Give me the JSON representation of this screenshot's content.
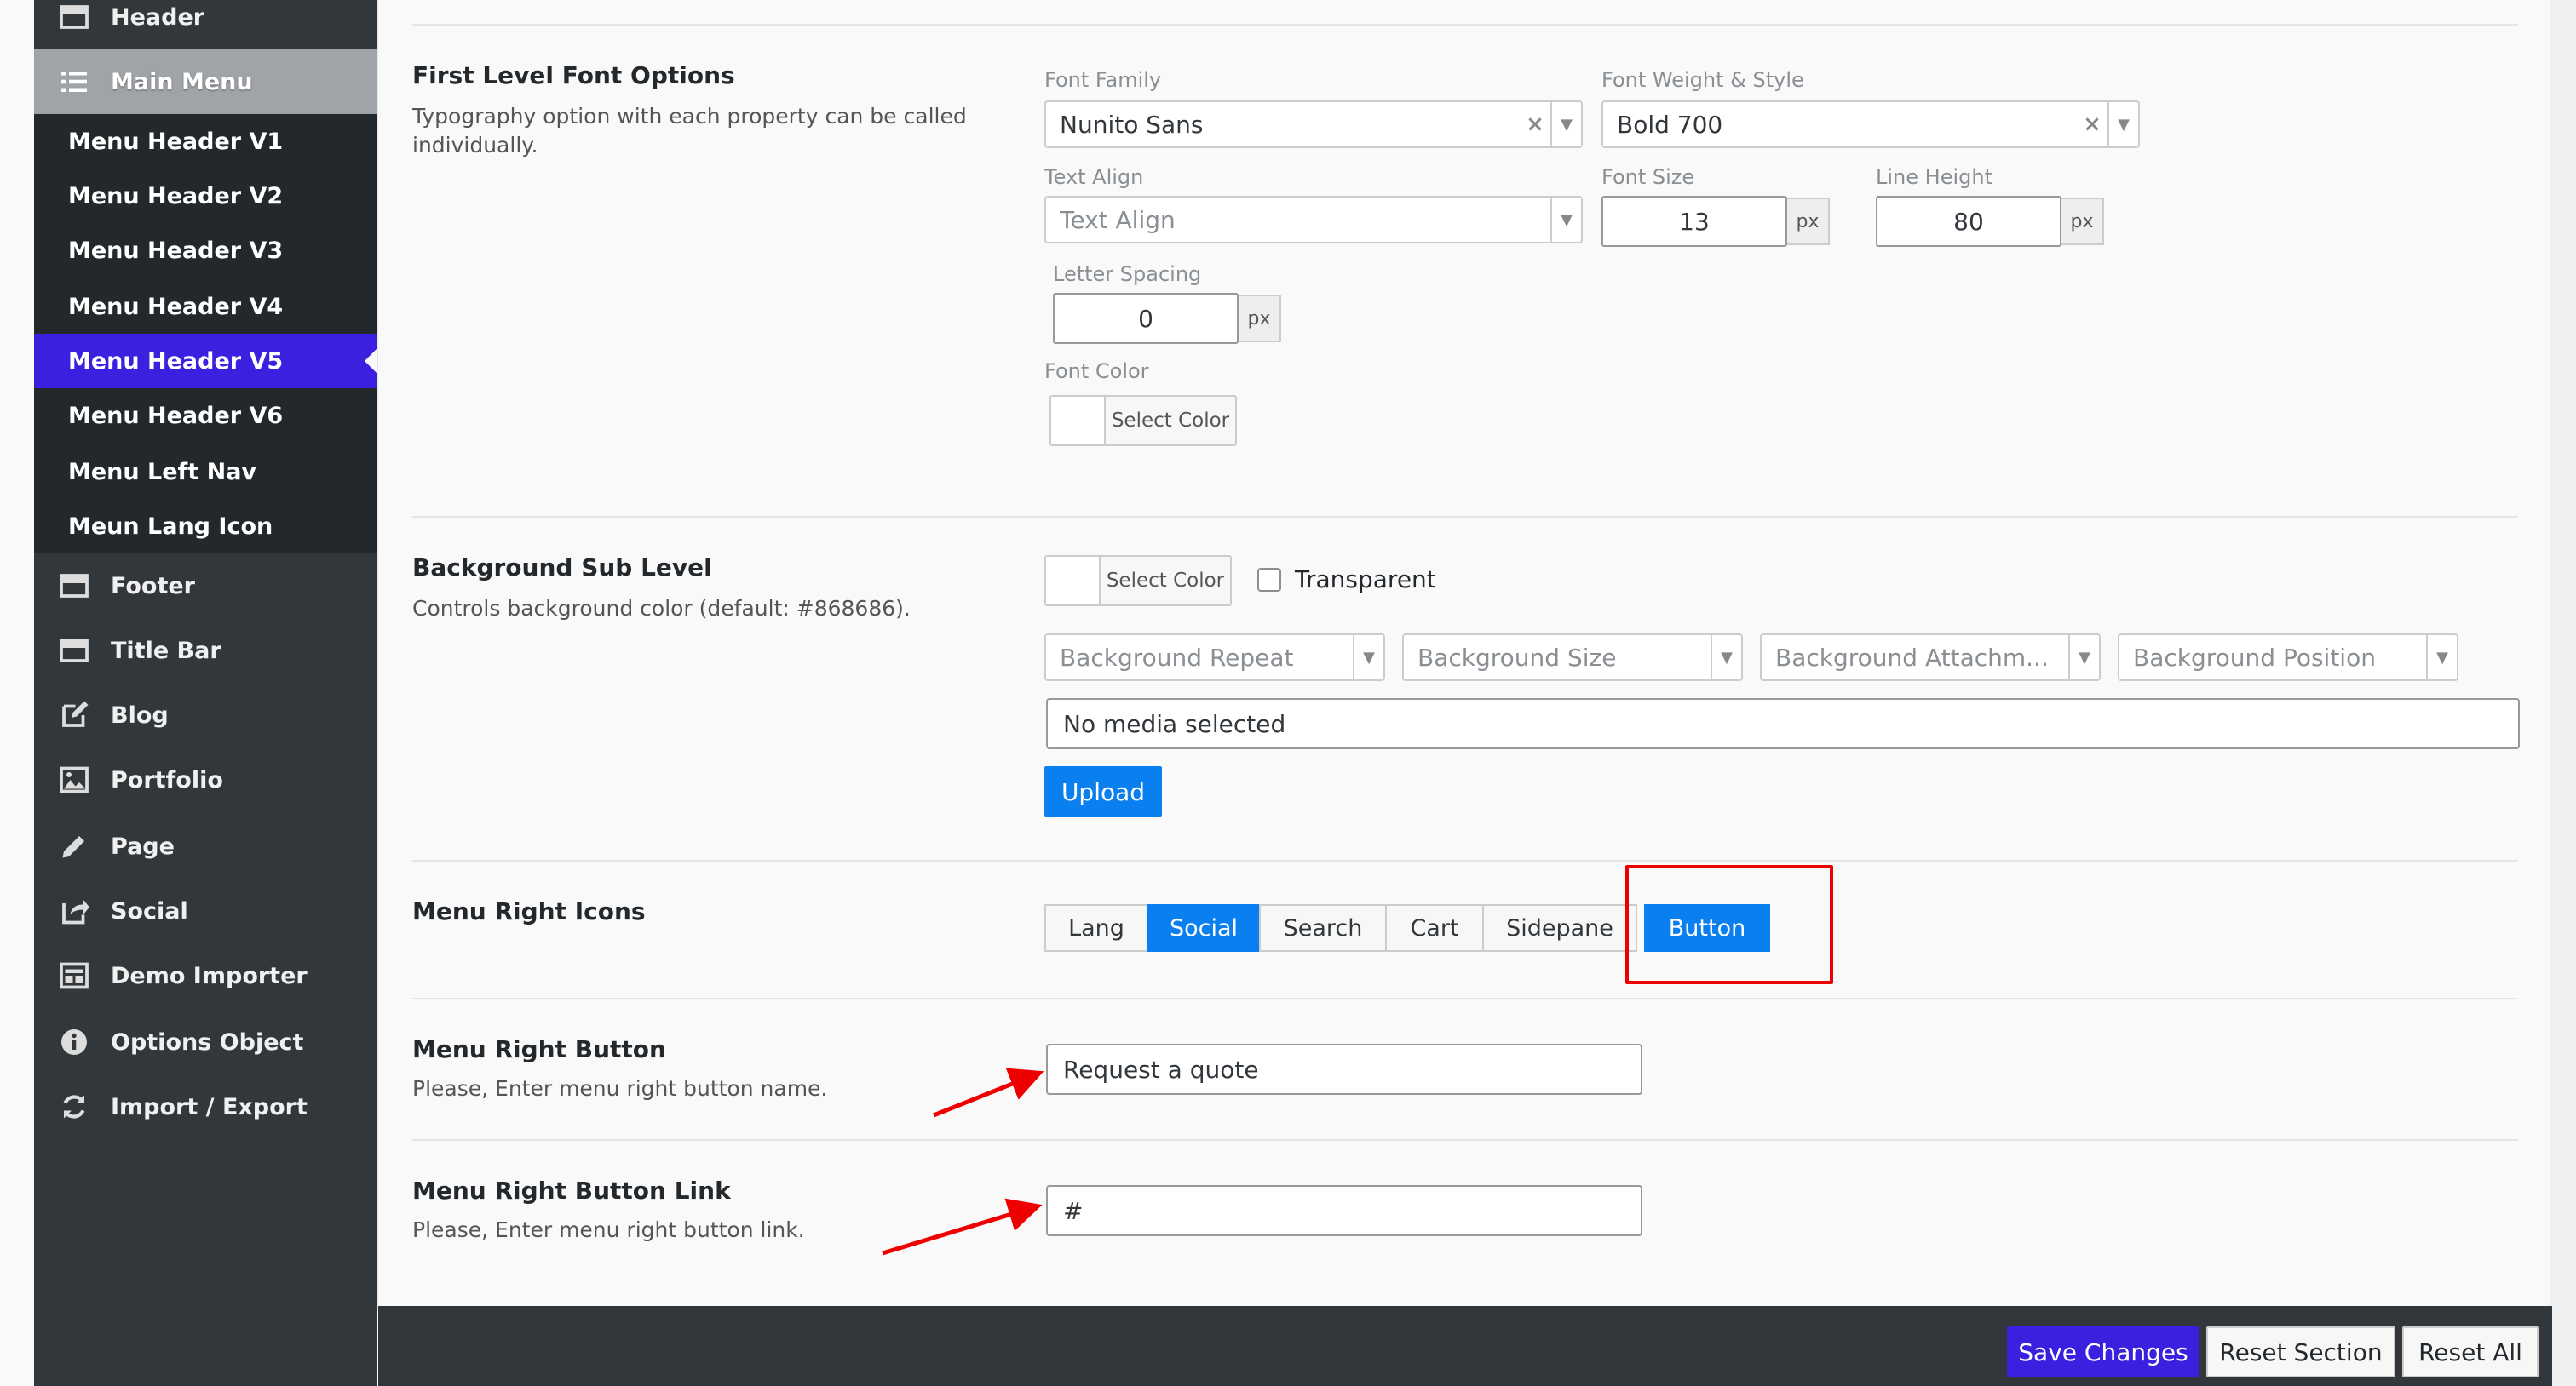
{
  "sidebar": {
    "header": "Header",
    "main_menu": "Main Menu",
    "submenu": [
      "Menu Header V1",
      "Menu Header V2",
      "Menu Header V3",
      "Menu Header V4",
      "Menu Header V5",
      "Menu Header V6",
      "Menu Left Nav",
      "Meun Lang Icon"
    ],
    "active_submenu": "Menu Header V5",
    "items": [
      "Footer",
      "Title Bar",
      "Blog",
      "Portfolio",
      "Page",
      "Social",
      "Demo Importer",
      "Options Object",
      "Import / Export"
    ]
  },
  "font_options": {
    "title": "First Level Font Options",
    "description": "Typography option with each property can be called individually.",
    "font_family_label": "Font Family",
    "font_family_value": "Nunito Sans",
    "font_weight_label": "Font Weight & Style",
    "font_weight_value": "Bold 700",
    "text_align_label": "Text Align",
    "text_align_placeholder": "Text Align",
    "font_size_label": "Font Size",
    "font_size_value": "13",
    "line_height_label": "Line Height",
    "line_height_value": "80",
    "letter_spacing_label": "Letter Spacing",
    "letter_spacing_value": "0",
    "unit": "px",
    "font_color_label": "Font Color",
    "select_color": "Select Color"
  },
  "background": {
    "title": "Background Sub Level",
    "description": "Controls background color (default: #868686).",
    "select_color": "Select Color",
    "transparent_label": "Transparent",
    "transparent_checked": false,
    "repeat_placeholder": "Background Repeat",
    "size_placeholder": "Background Size",
    "attachment_placeholder": "Background Attachm...",
    "position_placeholder": "Background Position",
    "media_text": "No media selected",
    "upload_label": "Upload"
  },
  "right_icons": {
    "title": "Menu Right Icons",
    "options": [
      "Lang",
      "Social",
      "Search",
      "Cart",
      "Sidepane",
      "Button"
    ],
    "selected": [
      "Social",
      "Button"
    ]
  },
  "right_button": {
    "title": "Menu Right Button",
    "description": "Please, Enter menu right button name.",
    "value": "Request a quote"
  },
  "right_button_link": {
    "title": "Menu Right Button Link",
    "description": "Please, Enter menu right button link.",
    "value": "#"
  },
  "footer": {
    "save": "Save Changes",
    "reset_section": "Reset Section",
    "reset_all": "Reset All"
  },
  "colors": {
    "sidebar_bg": "#32373c",
    "submenu_bg": "#23282d",
    "active_purple": "#3b20e0",
    "primary_blue": "#0a7ff0",
    "annotation_red": "#e00000"
  },
  "icons": {
    "header": "header-icon",
    "main_menu": "list-icon",
    "footer": "footer-icon",
    "title_bar": "title-bar-icon",
    "blog": "edit-icon",
    "portfolio": "image-icon",
    "page": "pencil-icon",
    "social": "share-icon",
    "demo_importer": "window-icon",
    "options_object": "info-icon",
    "import_export": "refresh-icon"
  }
}
